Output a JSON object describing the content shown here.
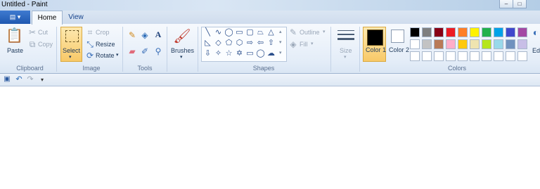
{
  "window": {
    "title": "Untitled - Paint",
    "controls": [
      "–",
      "□"
    ]
  },
  "appmenu": {
    "label": "▤ ▾"
  },
  "tabs": [
    {
      "label": "Home"
    },
    {
      "label": "View"
    }
  ],
  "clipboard": {
    "paste": "Paste",
    "cut": "Cut",
    "copy": "Copy",
    "group": "Clipboard"
  },
  "image": {
    "select": "Select",
    "crop": "Crop",
    "resize": "Resize",
    "rotate": "Rotate",
    "group": "Image"
  },
  "tools": {
    "group": "Tools"
  },
  "brushes": {
    "label": "Brushes"
  },
  "shapes": {
    "outline": "Outline",
    "fill": "Fill",
    "group": "Shapes"
  },
  "size": {
    "label": "Size"
  },
  "colors": {
    "color1": "Color 1",
    "color2": "Color 2",
    "edit": "Ed co",
    "group": "Colors",
    "row1": [
      "#000000",
      "#7f7f7f",
      "#880015",
      "#ed1c24",
      "#ff7f27",
      "#fff200",
      "#22b14c",
      "#00a2e8",
      "#3f48cc",
      "#a349a4"
    ],
    "row2": [
      "#ffffff",
      "#c3c3c3",
      "#b97a57",
      "#ffaec9",
      "#ffc90e",
      "#efe4b0",
      "#b5e61d",
      "#99d9ea",
      "#7092be",
      "#c8bfe7"
    ],
    "color1_value": "#000000",
    "color2_value": "#ffffff"
  },
  "qat": {
    "save": "💾",
    "undo": "↶",
    "redo": "↷",
    "customize": "▾"
  }
}
